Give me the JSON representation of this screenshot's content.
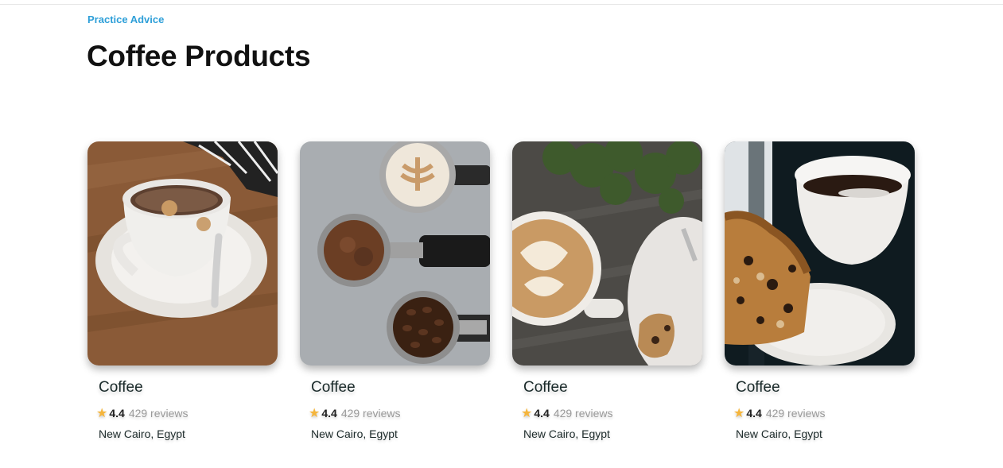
{
  "header": {
    "eyebrow": "Practice Advice",
    "title": "Coffee Products"
  },
  "products": [
    {
      "name": "Coffee",
      "rating": "4.4",
      "reviews": "429 reviews",
      "location": "New Cairo, Egypt",
      "image": "cappuccino-cup-on-wooden-table",
      "star_icon": "star-icon"
    },
    {
      "name": "Coffee",
      "rating": "4.4",
      "reviews": "429 reviews",
      "location": "New Cairo, Egypt",
      "image": "portafilters-with-grounds-and-beans",
      "star_icon": "star-icon"
    },
    {
      "name": "Coffee",
      "rating": "4.4",
      "reviews": "429 reviews",
      "location": "New Cairo, Egypt",
      "image": "latte-art-with-cookie",
      "star_icon": "star-icon"
    },
    {
      "name": "Coffee",
      "rating": "4.4",
      "reviews": "429 reviews",
      "location": "New Cairo, Egypt",
      "image": "black-coffee-with-cake",
      "star_icon": "star-icon"
    }
  ],
  "colors": {
    "accent": "#2e9fd8",
    "star": "#f5b53c",
    "muted": "#9a9a9a"
  }
}
